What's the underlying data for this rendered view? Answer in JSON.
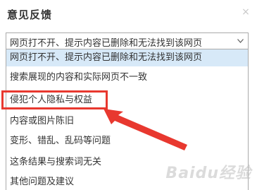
{
  "dialog": {
    "title": "意见反馈",
    "close_icon": "close-icon",
    "close_glyph": "×"
  },
  "select": {
    "value": "网页打不开、提示内容已删除和无法找到该网页",
    "icon": "chevron-down-icon"
  },
  "options": [
    {
      "label": "网页打不开、提示内容已删除和无法找到该网页",
      "selected": true
    },
    {
      "label": "搜索展现的内容和实际网页不一致",
      "selected": false
    },
    {
      "label": "侵犯个人隐私与权益",
      "selected": false
    },
    {
      "label": "内容或图片陈旧",
      "selected": false
    },
    {
      "label": "变形、错乱、乱码等问题",
      "selected": false
    },
    {
      "label": "这条结果与搜索词无关",
      "selected": false
    },
    {
      "label": "其他问题及建议",
      "selected": false
    }
  ],
  "annotation": {
    "highlighted_option": "侵犯个人隐私与权益",
    "color": "#e8382f"
  },
  "watermark": {
    "text": "Baidu经验"
  },
  "colors": {
    "selected_background": "#d7e9f8",
    "border": "#aaaaaa",
    "text": "#333333"
  }
}
